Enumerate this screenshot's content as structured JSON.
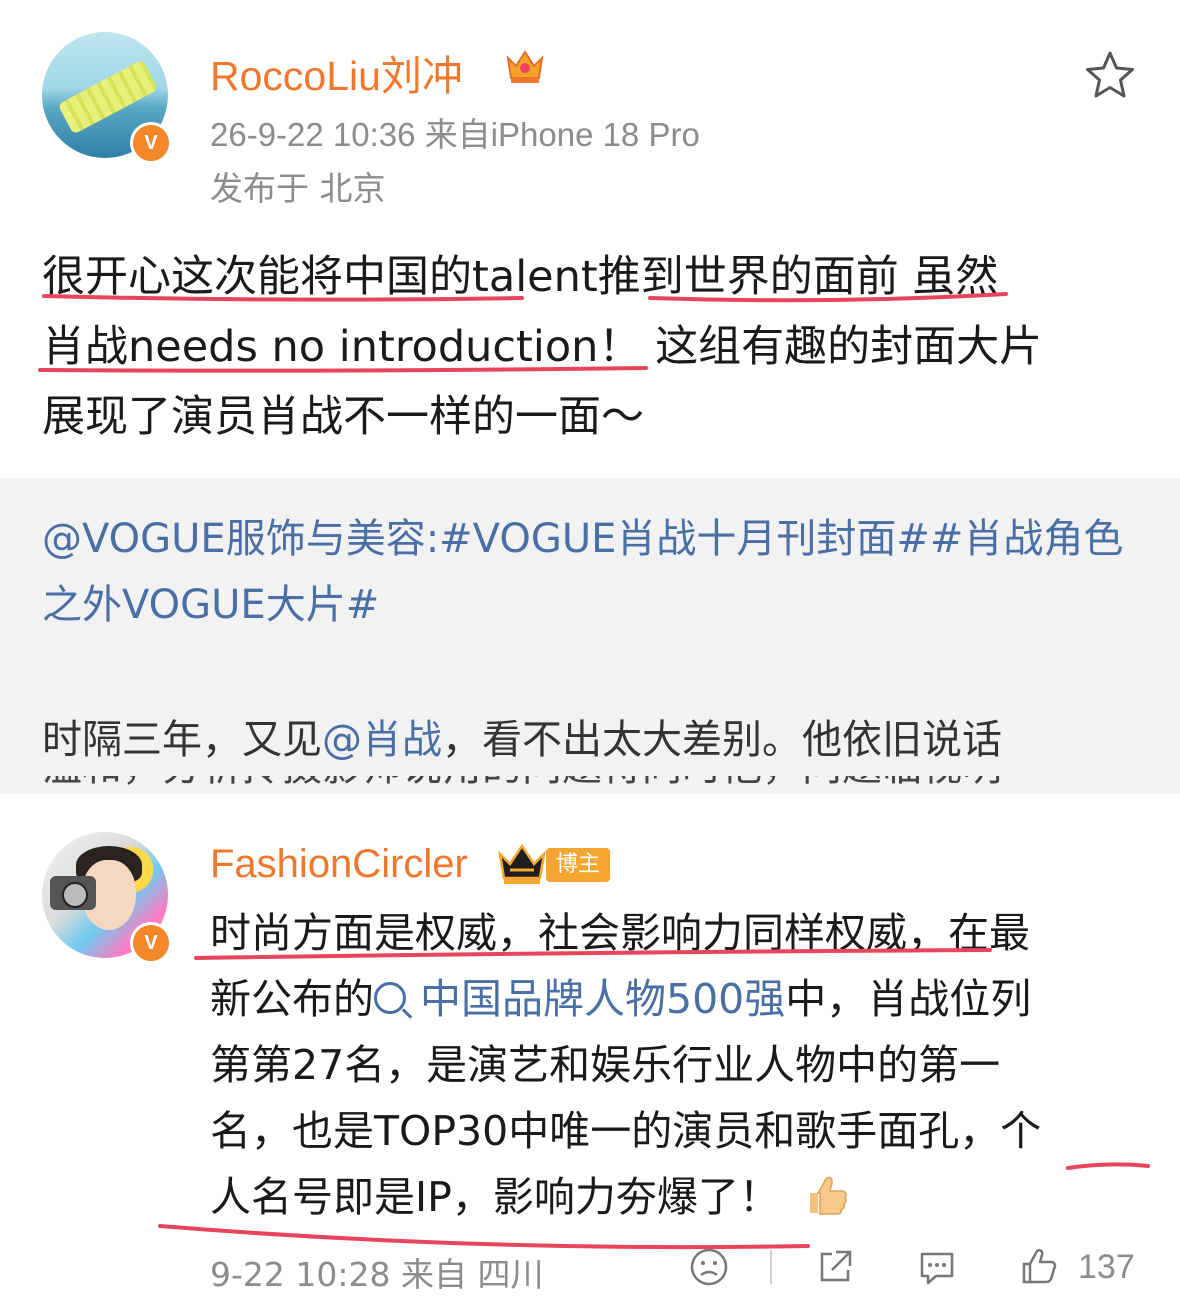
{
  "post": {
    "author": "RoccoLiu刘冲",
    "meta": "26-9-22 10:36  来自iPhone 18 Pro",
    "location": "发布于 北京",
    "verified_mark": "V",
    "text_lines": [
      "很开心这次能将中国的talent推到世界的面前 虽然",
      "肖战needs no introduction！ 这组有趣的封面大片",
      "展现了演员肖战不一样的一面～"
    ]
  },
  "repost": {
    "text": "@VOGUE服饰与美容:#VOGUE肖战十月刊封面##肖战角色之外VOGUE大片#",
    "more_prefix": "时隔三年，又见",
    "more_mention": "@肖战",
    "more_suffix": "，看不出太大差别。他依旧说话",
    "cut_line": "温和，分析拎摄影师说角的问题待同时他，问题临视明"
  },
  "comment": {
    "author": "FashionCircler",
    "badge": "博主",
    "verified_mark": "V",
    "line1": "时尚方面是权威，社会影响力同样权威，在最",
    "line2_prefix": "新公布的",
    "line2_link": "中国品牌人物500强",
    "line2_suffix": "中，肖战位列",
    "line3": "第第27名，是演艺和娱乐行业人物中的第一",
    "line4": "名，也是TOP30中唯一的演员和歌手面孔，个",
    "line5": "人名号即是IP，影响力夯爆了！",
    "meta": "9-22 10:28 来自 四川",
    "like_count": "137"
  },
  "icons": {
    "star": "star-icon",
    "crown": "crown-icon",
    "search": "search-icon",
    "thumbs_emoji": "thumbs-up-emoji",
    "face": "sad-face-icon",
    "share": "share-icon",
    "comment": "comment-icon",
    "like": "like-icon"
  },
  "colors": {
    "username": "#f0782d",
    "link": "#4a6fa5",
    "meta": "#8c8c8c",
    "annotation": "#e8455a"
  }
}
